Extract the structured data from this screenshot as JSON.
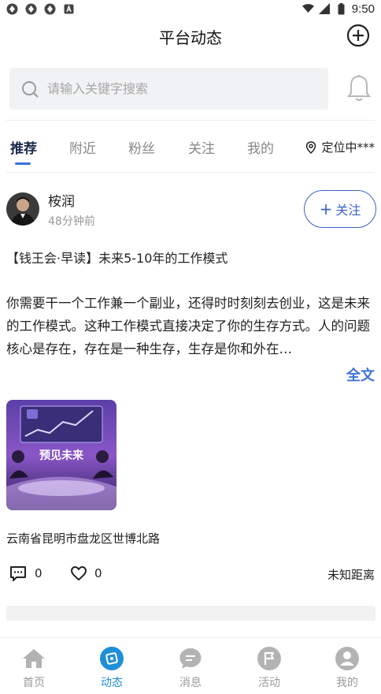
{
  "status_bar": {
    "time": "9:50"
  },
  "header": {
    "title": "平台动态"
  },
  "search": {
    "placeholder": "请输入关键字搜索"
  },
  "tabs": [
    {
      "label": "推荐",
      "active": true
    },
    {
      "label": "附近",
      "active": false
    },
    {
      "label": "粉丝",
      "active": false
    },
    {
      "label": "关注",
      "active": false
    },
    {
      "label": "我的",
      "active": false
    }
  ],
  "location_filter": {
    "label": "定位中***"
  },
  "post": {
    "author": "桉润",
    "time": "48分钟前",
    "follow_label": "关注",
    "title": "【钱王会·早读】未来5-10年的工作模式",
    "body": "你需要干一个工作兼一个副业，还得时时刻刻去创业，这是未来的工作模式。这种工作模式直接决定了你的生存方式。人的问题核心是存在，存在是一种生存，生存是你和外在…",
    "full_text_label": "全文",
    "image_caption": "预见未来",
    "location": "云南省昆明市盘龙区世博北路",
    "comments": "0",
    "likes": "0",
    "distance": "未知距离"
  },
  "bottom_nav": [
    {
      "label": "首页",
      "icon": "home-icon",
      "active": false
    },
    {
      "label": "动态",
      "icon": "feed-icon",
      "active": true
    },
    {
      "label": "消息",
      "icon": "message-icon",
      "active": false
    },
    {
      "label": "活动",
      "icon": "activity-flag-icon",
      "active": false
    },
    {
      "label": "我的",
      "icon": "profile-icon",
      "active": false
    }
  ],
  "colors": {
    "accent": "#3d63c9",
    "nav_active": "#1f8fd8",
    "link": "#3d73d8"
  }
}
